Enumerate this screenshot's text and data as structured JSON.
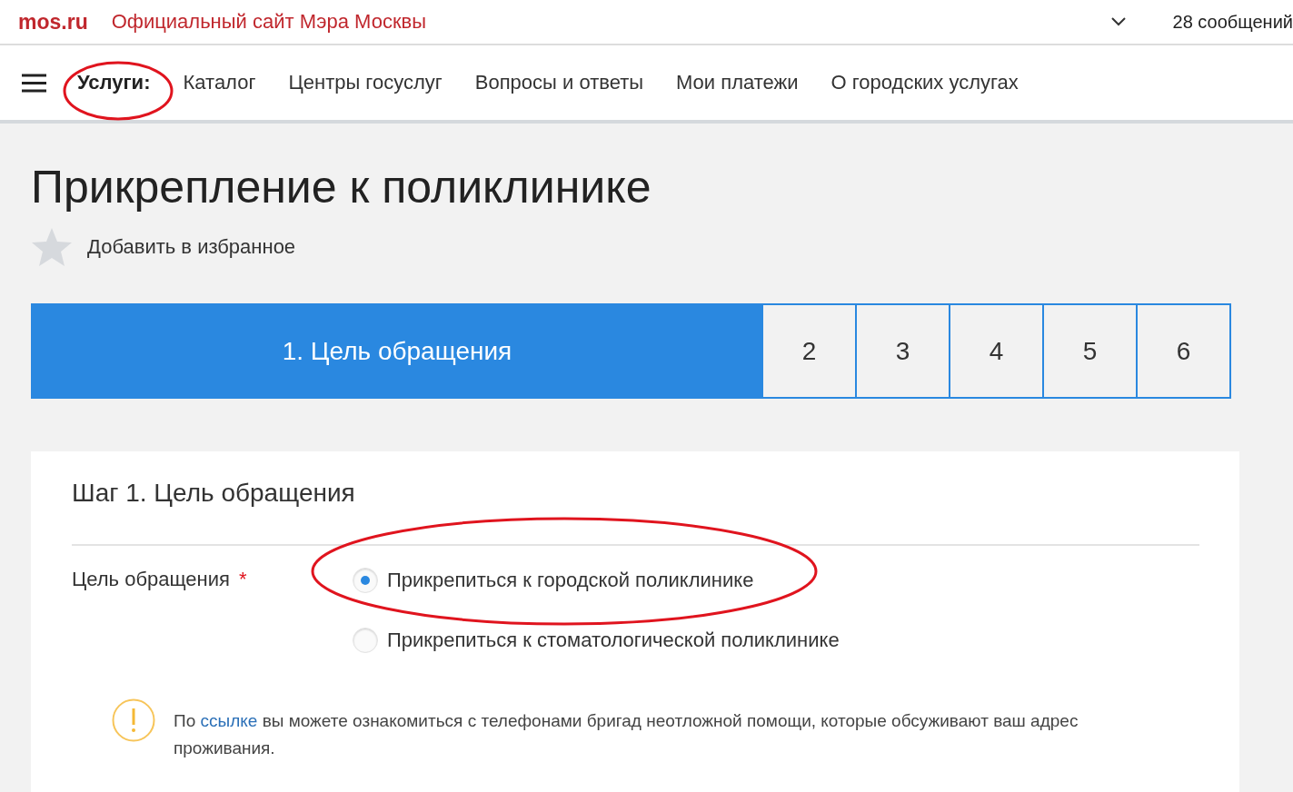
{
  "top_bar": {
    "logo": "mos.ru",
    "site_title": "Официальный сайт Мэра Москвы",
    "messages": "28 сообщений"
  },
  "nav": {
    "label": "Услуги:",
    "items": [
      "Каталог",
      "Центры госуслуг",
      "Вопросы и ответы",
      "Мои платежи",
      "О городских услугах"
    ]
  },
  "page": {
    "title": "Прикрепление к поликлинике",
    "favorite": "Добавить в избранное"
  },
  "steps": [
    {
      "label": "1. Цель обращения",
      "selected": true
    },
    {
      "label": "2",
      "selected": false
    },
    {
      "label": "3",
      "selected": false
    },
    {
      "label": "4",
      "selected": false
    },
    {
      "label": "5",
      "selected": false
    },
    {
      "label": "6",
      "selected": false
    }
  ],
  "form": {
    "heading": "Шаг 1. Цель обращения",
    "field_label": "Цель обращения",
    "required_mark": "*",
    "options": [
      {
        "label": "Прикрепиться к городской поликлинике",
        "selected": true
      },
      {
        "label": "Прикрепиться к стоматологической поликлинике",
        "selected": false
      }
    ],
    "notice": {
      "before": "По ",
      "link": "ссылке",
      "after": " вы можете ознакомиться с телефонами бригад неотложной помощи, которые обсуживают ваш адрес проживания."
    }
  }
}
